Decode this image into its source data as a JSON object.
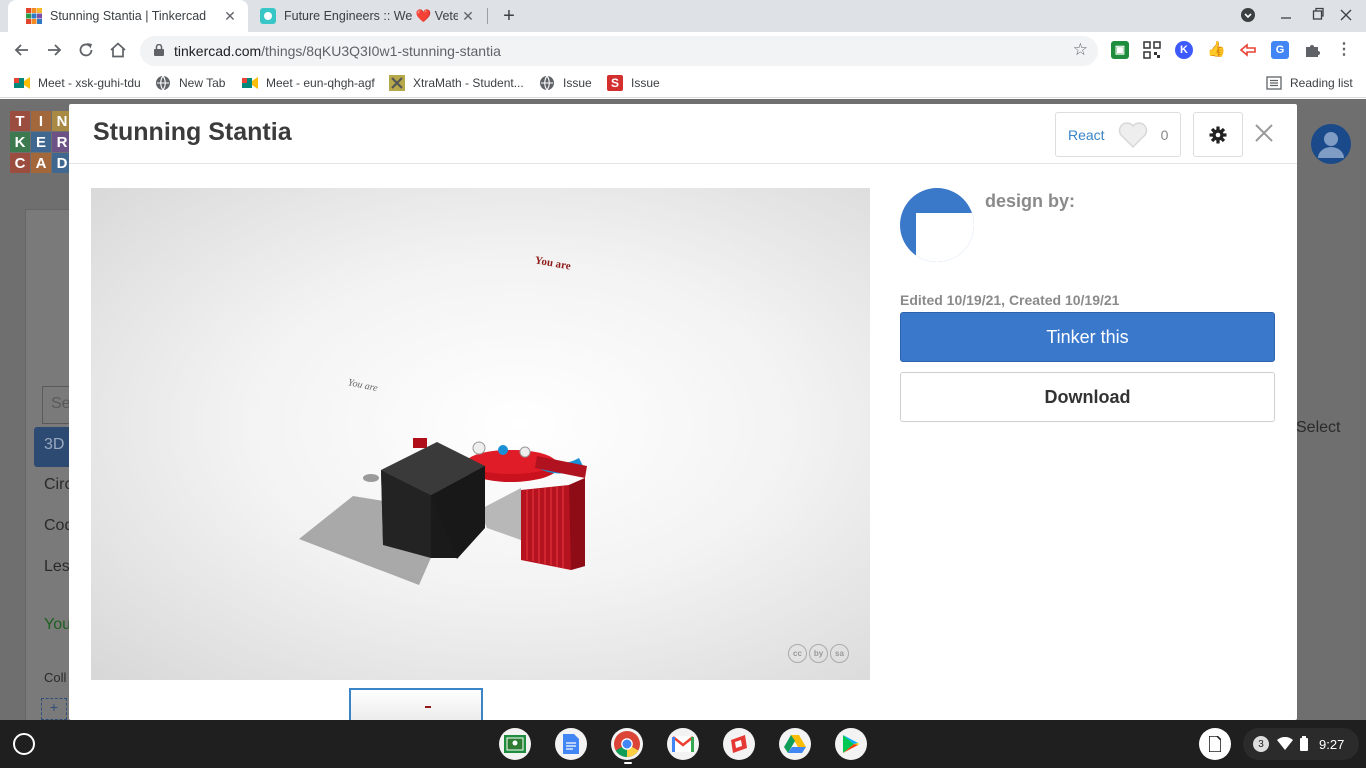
{
  "browser": {
    "tabs": [
      {
        "title": "Stunning Stantia | Tinkercad",
        "active": true,
        "favicon": "tinkercad-icon"
      },
      {
        "title": "Future Engineers :: We ❤️ Vetera",
        "active": false,
        "favicon": "future-engineers-icon"
      }
    ],
    "new_tab_label": "+",
    "url": {
      "host": "tinkercad.com",
      "path": "/things/8qKU3Q3I0w1-stunning-stantia"
    },
    "extensions": [
      {
        "name": "google-classroom-extension-icon",
        "color": "#1e8e3e"
      },
      {
        "name": "qr-code-extension-icon",
        "color": "#333333"
      },
      {
        "name": "k-extension-icon",
        "color": "#3d5afe",
        "label": "K"
      },
      {
        "name": "thumbs-up-extension-icon",
        "color": "#fbbc04"
      },
      {
        "name": "screencast-extension-icon",
        "color": "#ea4335"
      },
      {
        "name": "google-translate-extension-icon",
        "color": "#4285f4"
      },
      {
        "name": "puzzle-extensions-icon",
        "color": "#5f6368"
      }
    ],
    "bookmarks": [
      {
        "label": "Meet - xsk-guhi-tdu",
        "icon": "google-meet-icon"
      },
      {
        "label": "New Tab",
        "icon": "globe-icon"
      },
      {
        "label": "Meet - eun-qhgh-agf",
        "icon": "google-meet-icon"
      },
      {
        "label": "XtraMath - Student...",
        "icon": "xtramath-icon"
      },
      {
        "label": "Issue",
        "icon": "globe-icon"
      },
      {
        "label": "Issue",
        "icon": "s-icon"
      }
    ],
    "reading_list_label": "Reading list"
  },
  "background_page": {
    "logo_letters": [
      "T",
      "I",
      "N",
      "K",
      "E",
      "R",
      "C",
      "A",
      "D"
    ],
    "logo_colors": [
      "#e2462a",
      "#f08a24",
      "#f5b92f",
      "#2b9a47",
      "#2f78c4",
      "#7e4fa7",
      "#e2462a",
      "#f08a24",
      "#2f78c4"
    ],
    "items": [
      "Sea",
      "3D",
      "Circ",
      "Cod",
      "Les",
      "You",
      "Coll",
      "+",
      "Select"
    ]
  },
  "modal": {
    "title": "Stunning Stantia",
    "react_label": "React",
    "react_count": "0",
    "design_by_label": "design by:",
    "dates": "Edited 10/19/21, Created 10/19/21",
    "tinker_button": "Tinker this",
    "download_button": "Download",
    "viewer_text_a": "You are",
    "viewer_text_b": "You are",
    "license_badges": [
      "cc",
      "by",
      "sa"
    ]
  },
  "shelf": {
    "apps": [
      {
        "name": "google-classroom-app-icon",
        "color": "#1e8e3e"
      },
      {
        "name": "google-docs-app-icon",
        "color": "#4285f4"
      },
      {
        "name": "chrome-app-icon",
        "color": "#ea4335"
      },
      {
        "name": "gmail-app-icon",
        "color": "#ffffff"
      },
      {
        "name": "screencastify-app-icon",
        "color": "#ea4335"
      },
      {
        "name": "google-drive-app-icon",
        "color": "#fbbc04"
      },
      {
        "name": "play-store-app-icon",
        "color": "#34a853"
      }
    ],
    "notification_count": "3",
    "time": "9:27"
  }
}
